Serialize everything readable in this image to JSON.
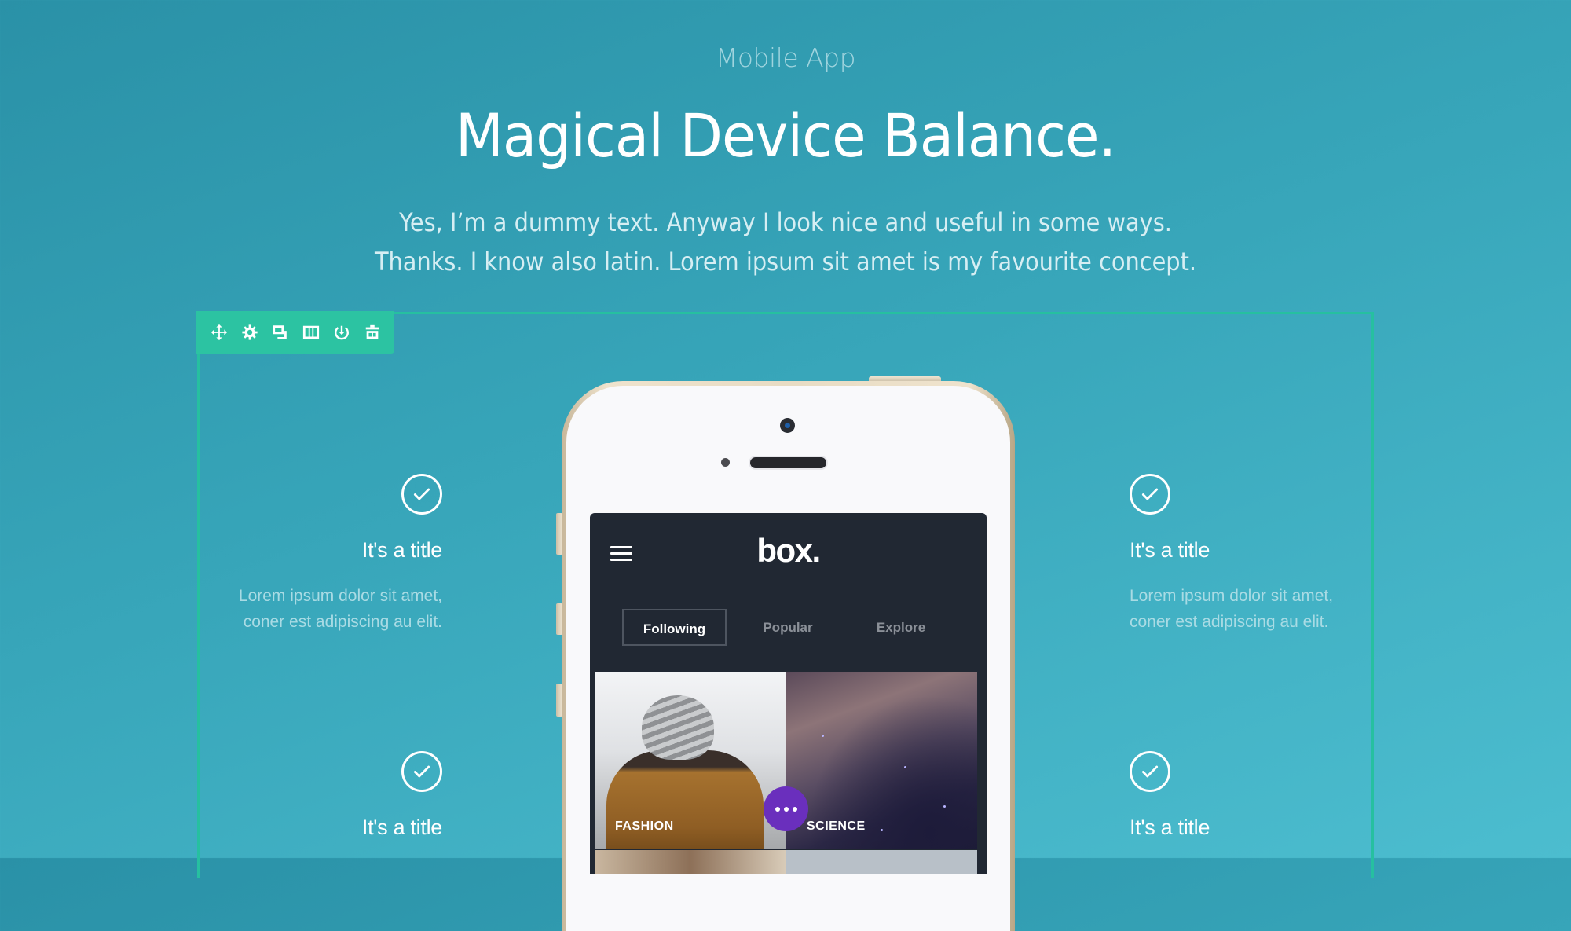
{
  "header": {
    "eyebrow": "Mobile App",
    "title": "Magical Device Balance.",
    "lead_lines": [
      "Yes, I’m a dummy text. Anyway I look nice and useful in some ways.",
      "Thanks. I know also latin. Lorem ipsum sit amet is my favourite concept."
    ]
  },
  "toolbar": {
    "items": [
      {
        "icon": "move-icon",
        "label": "Move"
      },
      {
        "icon": "gear-icon",
        "label": "Settings"
      },
      {
        "icon": "duplicate-icon",
        "label": "Duplicate"
      },
      {
        "icon": "columns-icon",
        "label": "Columns"
      },
      {
        "icon": "save-icon",
        "label": "Save"
      },
      {
        "icon": "trash-icon",
        "label": "Delete"
      }
    ],
    "color": "#2cc3a2"
  },
  "features": {
    "left": [
      {
        "title": "It's a title",
        "body_lines": [
          "Lorem ipsum dolor sit amet,",
          "coner est adipiscing au elit."
        ]
      },
      {
        "title": "It's a title",
        "body_lines": []
      }
    ],
    "right": [
      {
        "title": "It's a title",
        "body_lines": [
          "Lorem ipsum dolor sit amet,",
          "coner est adipiscing au elit."
        ]
      },
      {
        "title": "It's a title",
        "body_lines": []
      }
    ]
  },
  "phone_app": {
    "logo": "box.",
    "menu_icon": "hamburger-icon",
    "tabs": [
      {
        "label": "Following",
        "active": true
      },
      {
        "label": "Popular",
        "active": false
      },
      {
        "label": "Explore",
        "active": false
      }
    ],
    "tiles": [
      {
        "label": "FASHION"
      },
      {
        "label": "SCIENCE"
      }
    ],
    "fab_icon": "more-horizontal-icon",
    "fab_color": "#6a2fbd"
  },
  "colors": {
    "bg_start": "#2a91a7",
    "bg_end": "#4cbdcf",
    "selection_border": "#26c0a0"
  }
}
